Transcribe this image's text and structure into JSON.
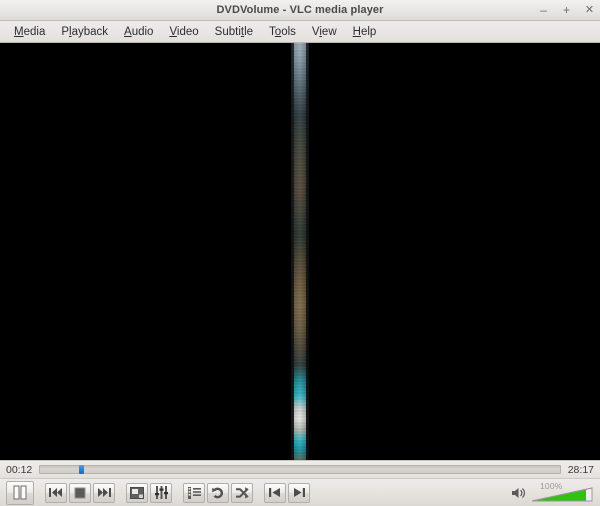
{
  "window": {
    "title": "DVDVolume - VLC media player",
    "controls": {
      "minimize": "–",
      "maximize": "+",
      "close": "✕"
    }
  },
  "menubar": {
    "items": [
      {
        "label": "Media",
        "mnemonic": "M",
        "pre": "",
        "post": "edia"
      },
      {
        "label": "Playback",
        "mnemonic": "l",
        "pre": "P",
        "post": "ayback"
      },
      {
        "label": "Audio",
        "mnemonic": "A",
        "pre": "",
        "post": "udio"
      },
      {
        "label": "Video",
        "mnemonic": "V",
        "pre": "",
        "post": "ideo"
      },
      {
        "label": "Subtitle",
        "mnemonic": "t",
        "pre": "Subti",
        "post": "le"
      },
      {
        "label": "Tools",
        "mnemonic": "o",
        "pre": "T",
        "post": "ols"
      },
      {
        "label": "View",
        "mnemonic": "i",
        "pre": "V",
        "post": "ew"
      },
      {
        "label": "Help",
        "mnemonic": "H",
        "pre": "",
        "post": "elp"
      }
    ]
  },
  "video": {
    "background_color": "#000000",
    "description": "narrow vertical video strip centered in black canvas"
  },
  "seekbar": {
    "elapsed": "00:12",
    "remaining": "28:17",
    "position_percent": 7.5,
    "handle_color": "#2d7fcf"
  },
  "controls": {
    "play_pause": {
      "name": "pause",
      "label": "Pause"
    },
    "previous": {
      "label": "Previous"
    },
    "stop": {
      "label": "Stop"
    },
    "next": {
      "label": "Next"
    },
    "toggle_fullscreen": {
      "label": "Toggle fullscreen"
    },
    "extended_settings": {
      "label": "Show extended settings"
    },
    "playlist": {
      "label": "Show playlist"
    },
    "loop": {
      "label": "Loop"
    },
    "shuffle": {
      "label": "Random"
    },
    "frame_prev": {
      "label": "Previous chapter"
    },
    "frame_next": {
      "label": "Next chapter"
    }
  },
  "volume": {
    "level_text": "100%",
    "level_percent": 100,
    "fill_color": "#2fc20f",
    "muted": false
  }
}
